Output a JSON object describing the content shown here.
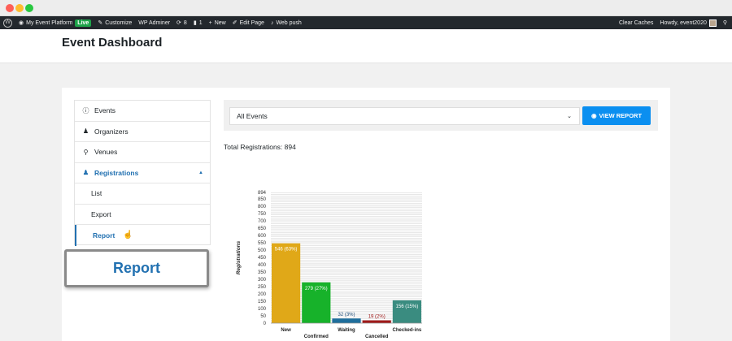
{
  "adminbar": {
    "site": "My Event Platform",
    "live": "Live",
    "customize": "Customize",
    "wp_adminer": "WP Adminer",
    "updates": "8",
    "comments": "1",
    "new": "New",
    "edit_page": "Edit Page",
    "web_push": "Web push",
    "clear_caches": "Clear Caches",
    "howdy": "Howdy, event2020"
  },
  "page": {
    "title": "Event Dashboard"
  },
  "sidebar": {
    "items": [
      {
        "label": "Events",
        "icon": "info-circle-icon"
      },
      {
        "label": "Organizers",
        "icon": "user-icon"
      },
      {
        "label": "Venues",
        "icon": "map-pin-icon"
      },
      {
        "label": "Registrations",
        "icon": "users-icon"
      },
      {
        "label": "List"
      },
      {
        "label": "Export"
      },
      {
        "label": "Report"
      }
    ]
  },
  "callout": {
    "label": "Report"
  },
  "filter": {
    "selected": "All Events",
    "button_label": "VIEW REPORT"
  },
  "summary": {
    "total_text": "Total Registrations: 894"
  },
  "colors": {
    "accent": "#2271b1",
    "button": "#0b8ff0"
  },
  "chart_data": {
    "type": "bar",
    "ylabel": "Registrations",
    "ylim": [
      0,
      894
    ],
    "yticks": [
      0,
      50,
      100,
      150,
      200,
      250,
      300,
      350,
      400,
      450,
      500,
      550,
      600,
      650,
      700,
      750,
      800,
      850,
      894
    ],
    "categories": [
      "New",
      "Confirmed",
      "Waiting",
      "Cancelled",
      "Checked-ins"
    ],
    "values": [
      546,
      279,
      32,
      19,
      156
    ],
    "labels": [
      "546 (63%)",
      "279 (27%)",
      "32 (3%)",
      "19 (2%)",
      "156 (15%)"
    ],
    "colors": [
      "#e0a818",
      "#17b22a",
      "#1f6e9c",
      "#a01a1a",
      "#3a8c80"
    ],
    "grid": true
  }
}
